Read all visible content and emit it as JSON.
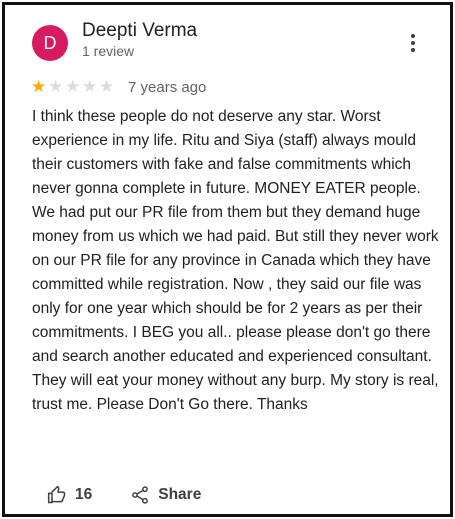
{
  "reviewer": {
    "initial": "D",
    "avatar_color": "#d81b60",
    "name": "Deepti Verma",
    "review_count": "1 review"
  },
  "review": {
    "rating": 1,
    "max_rating": 5,
    "star_color": "#f9ab00",
    "time_ago": "7 years ago",
    "text": "I think these people do not deserve any star. Worst experience in my life. Ritu and Siya (staff) always mould their customers with fake and false commitments which never gonna complete in future. MONEY EATER people. We had put our PR file from them but they demand huge money from us which we had paid. But still they never work on our PR file for any province in Canada which they have committed while registration. Now , they said our file was only for one year which should be for 2 years as per their commitments. I BEG you all.. please please don't go there and search another educated and experienced consultant. They will eat your money without any burp. My story is real, trust me. Please Don't Go there. Thanks"
  },
  "actions": {
    "like_icon": "thumbs-up-icon",
    "like_count": "16",
    "share_icon": "share-icon",
    "share_label": "Share"
  },
  "menu": {
    "icon": "more-vert-icon"
  }
}
